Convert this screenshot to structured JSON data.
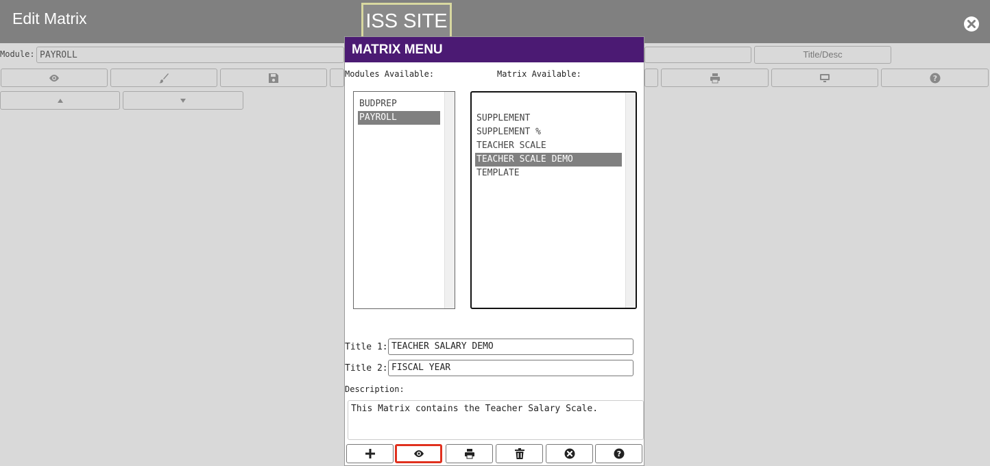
{
  "app": {
    "title": "Edit Matrix",
    "site": "ISS SITE"
  },
  "header": {
    "module_label": "Module:",
    "module_value": "PAYROLL",
    "title_desc_placeholder": "Title/Desc"
  },
  "toolbar": {
    "icons": [
      "eye-icon",
      "brush-icon",
      "save-icon",
      "print-icon",
      "monitor-icon",
      "help-icon",
      "up-arrow-icon",
      "down-arrow-icon"
    ]
  },
  "dialog": {
    "title": "MATRIX MENU",
    "modules_label": "Modules Available:",
    "matrix_label": "Matrix Available:",
    "modules": [
      "BUDPREP",
      "PAYROLL"
    ],
    "modules_selected": "PAYROLL",
    "matrix_items": [
      "SUPPLEMENT",
      "SUPPLEMENT %",
      "TEACHER SCALE",
      "TEACHER SCALE DEMO",
      "TEMPLATE"
    ],
    "matrix_selected": "TEACHER SCALE DEMO",
    "title1_label": "Title 1:",
    "title1_value": "TEACHER SALARY DEMO",
    "title2_label": "Title 2:",
    "title2_value": "FISCAL YEAR",
    "description_label": "Description:",
    "description_value": "This Matrix contains the Teacher Salary Scale.",
    "buttons": [
      "add-icon",
      "view-icon",
      "print-icon",
      "delete-icon",
      "cancel-icon",
      "help-icon"
    ]
  },
  "colors": {
    "dialog_header": "#4b1a73",
    "highlight": "#e0301e",
    "topbar": "#808080"
  }
}
